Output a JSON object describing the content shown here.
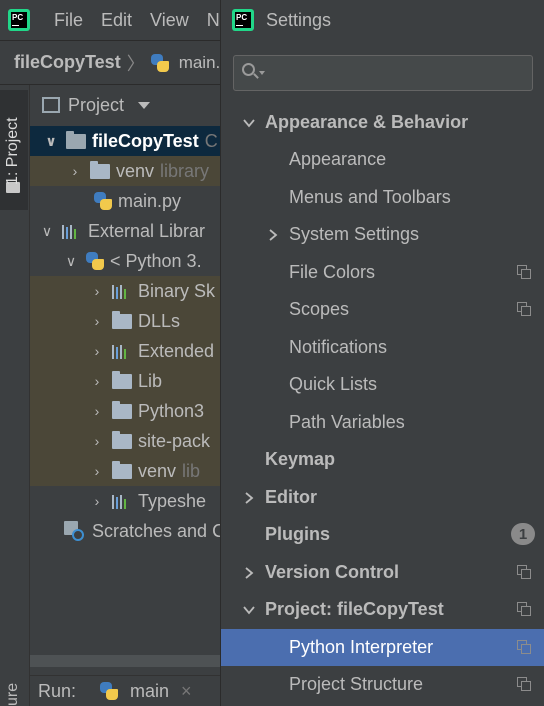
{
  "ide": {
    "menu": [
      "File",
      "Edit",
      "View",
      "N"
    ],
    "breadcrumb": {
      "project": "fileCopyTest",
      "file": "main."
    },
    "side_tabs": {
      "project": "1: Project",
      "structure": "ure"
    },
    "project_panel": {
      "title": "Project",
      "rows": [
        {
          "label": "fileCopyTest",
          "suffix": "C"
        },
        {
          "label": "venv",
          "suffix": "library"
        },
        {
          "label": "main.py",
          "suffix": ""
        },
        {
          "label": "External Librar",
          "suffix": ""
        },
        {
          "label": "< Python 3.",
          "suffix": ""
        },
        {
          "label": "Binary Sk",
          "suffix": ""
        },
        {
          "label": "DLLs",
          "suffix": ""
        },
        {
          "label": "Extended",
          "suffix": ""
        },
        {
          "label": "Lib",
          "suffix": ""
        },
        {
          "label": "Python3",
          "suffix": ""
        },
        {
          "label": "site-pack",
          "suffix": ""
        },
        {
          "label": "venv",
          "suffix": "lib"
        },
        {
          "label": "Typeshe",
          "suffix": ""
        },
        {
          "label": "Scratches and C",
          "suffix": ""
        }
      ]
    },
    "run_bar": {
      "label": "Run:",
      "tab": "main",
      "close": "×"
    }
  },
  "settings": {
    "title": "Settings",
    "search": {
      "value": "",
      "placeholder": ""
    },
    "items": [
      {
        "label": "Appearance & Behavior"
      },
      {
        "label": "Appearance"
      },
      {
        "label": "Menus and Toolbars"
      },
      {
        "label": "System Settings"
      },
      {
        "label": "File Colors"
      },
      {
        "label": "Scopes"
      },
      {
        "label": "Notifications"
      },
      {
        "label": "Quick Lists"
      },
      {
        "label": "Path Variables"
      },
      {
        "label": "Keymap"
      },
      {
        "label": "Editor"
      },
      {
        "label": "Plugins",
        "badge": "1"
      },
      {
        "label": "Version Control"
      },
      {
        "label": "Project: fileCopyTest"
      },
      {
        "label": "Python Interpreter"
      },
      {
        "label": "Project Structure"
      }
    ]
  },
  "colors": {
    "accent_selection": "#4b6eaf",
    "panel_bg": "#3c3f41",
    "library_highlight": "#4b4738",
    "tree_selection": "#0d293e"
  }
}
